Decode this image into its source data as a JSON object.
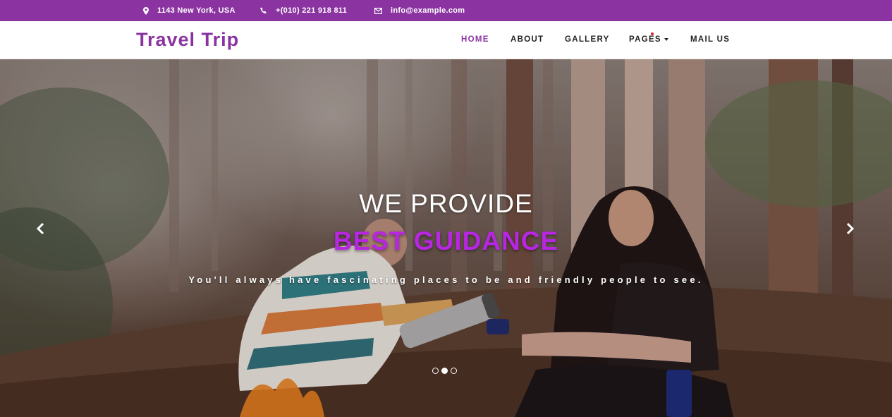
{
  "topbar": {
    "address": "1143 New York, USA",
    "phone": "+(010) 221 918 811",
    "email": "info@example.com",
    "icons": [
      "map-marker-icon",
      "phone-icon",
      "envelope-icon"
    ],
    "background": "#8a33a1"
  },
  "navbar": {
    "brand": "Travel Trip",
    "items": [
      {
        "label": "HOME",
        "active": true
      },
      {
        "label": "ABOUT",
        "active": false
      },
      {
        "label": "GALLERY",
        "active": false
      },
      {
        "label": "PAGES",
        "active": false,
        "dropdown": true
      },
      {
        "label": "MAIL US",
        "active": false
      }
    ],
    "brand_color": "#8a33a1"
  },
  "hero": {
    "line1": "WE PROVIDE",
    "line2": "BEST GUIDANCE",
    "subtitle": "You'll always have fascinating places to be and friendly people to see.",
    "highlight_color": "#b726e0",
    "slides": 3,
    "active_slide": 2,
    "prev_icon": "chevron-left-icon",
    "next_icon": "chevron-right-icon"
  }
}
